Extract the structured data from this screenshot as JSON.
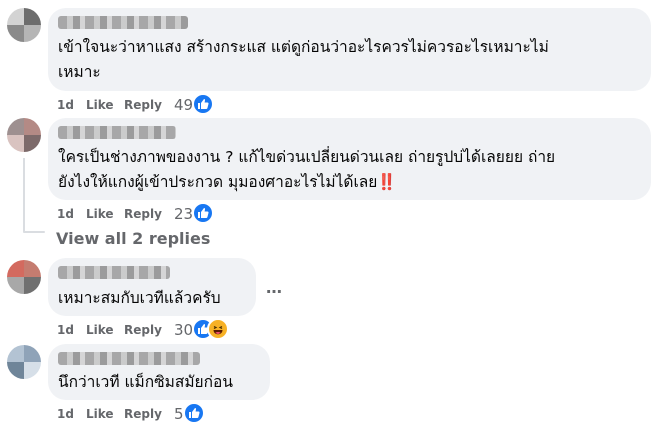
{
  "comments": [
    {
      "text_lines": [
        "เข้าใจนะว่าหาแสง สร้างกระแส แต่ดูก่อนว่าอะไรควรไม่ควรอะไรเหมาะไม่",
        "เหมาะ"
      ],
      "time": "1d",
      "like": "Like",
      "reply": "Reply",
      "reactions": "49",
      "reaction_icons": [
        "like-icon"
      ]
    },
    {
      "text_lines": [
        "ใครเป็นช่างภาพของงาน ? แก้ไขด่วนเปลี่ยนด่วนเลย ถ่ายรูปบ่ได้เลยยย ถ่าย",
        "ยังไงให้แกงผู้เข้าประกวด มุมองศาอะไรไม่ได้เลย"
      ],
      "emoji": "‼️",
      "time": "1d",
      "like": "Like",
      "reply": "Reply",
      "reactions": "23",
      "reaction_icons": [
        "like-icon"
      ]
    },
    {
      "text_lines": [
        "เหมาะสมกับเวทีแล้วครับ"
      ],
      "time": "1d",
      "like": "Like",
      "reply": "Reply",
      "reactions": "30",
      "reaction_icons": [
        "like-icon",
        "haha-icon"
      ],
      "more": "…"
    },
    {
      "text_lines": [
        "นึกว่าเวที แม็กซิมสมัยก่อน"
      ],
      "time": "1d",
      "like": "Like",
      "reply": "Reply",
      "reactions": "5",
      "reaction_icons": [
        "like-icon"
      ]
    }
  ],
  "view_replies": "View all 2 replies",
  "colors": {
    "bubble": "#f0f2f5",
    "meta": "#65676b",
    "like_blue": "#1877f2",
    "haha_yellow": "#f7b125"
  }
}
